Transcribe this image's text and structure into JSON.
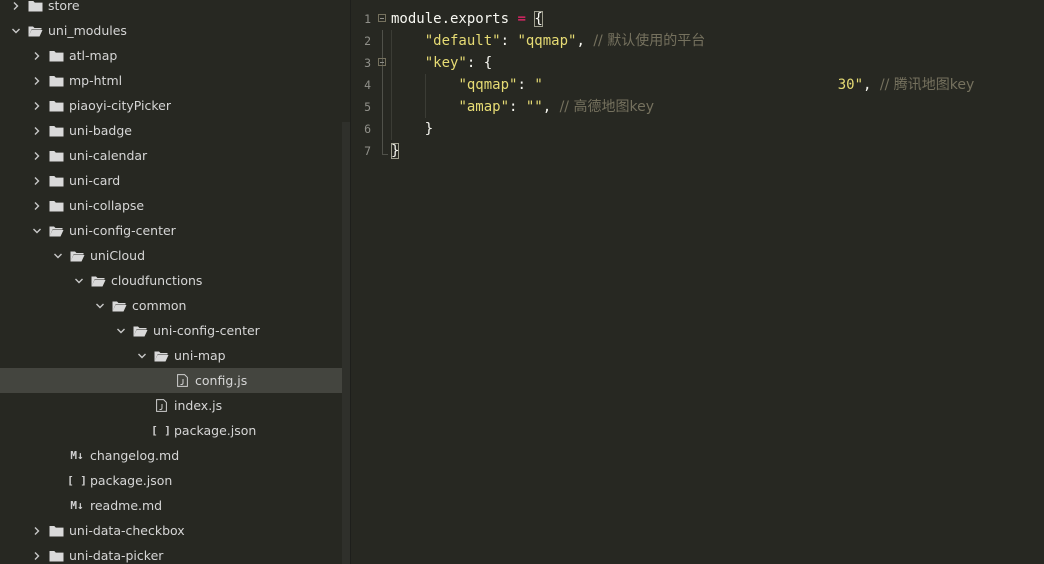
{
  "explorer": {
    "rows": [
      {
        "label": "store",
        "type": "folder",
        "expanded": false,
        "depth": 0
      },
      {
        "label": "uni_modules",
        "type": "folder",
        "expanded": true,
        "depth": 0
      },
      {
        "label": "atl-map",
        "type": "folder",
        "expanded": false,
        "depth": 1
      },
      {
        "label": "mp-html",
        "type": "folder",
        "expanded": false,
        "depth": 1
      },
      {
        "label": "piaoyi-cityPicker",
        "type": "folder",
        "expanded": false,
        "depth": 1
      },
      {
        "label": "uni-badge",
        "type": "folder",
        "expanded": false,
        "depth": 1
      },
      {
        "label": "uni-calendar",
        "type": "folder",
        "expanded": false,
        "depth": 1
      },
      {
        "label": "uni-card",
        "type": "folder",
        "expanded": false,
        "depth": 1
      },
      {
        "label": "uni-collapse",
        "type": "folder",
        "expanded": false,
        "depth": 1
      },
      {
        "label": "uni-config-center",
        "type": "folder",
        "expanded": true,
        "depth": 1
      },
      {
        "label": "uniCloud",
        "type": "folder",
        "expanded": true,
        "depth": 2
      },
      {
        "label": "cloudfunctions",
        "type": "folder",
        "expanded": true,
        "depth": 3
      },
      {
        "label": "common",
        "type": "folder",
        "expanded": true,
        "depth": 4
      },
      {
        "label": "uni-config-center",
        "type": "folder",
        "expanded": true,
        "depth": 5
      },
      {
        "label": "uni-map",
        "type": "folder",
        "expanded": true,
        "depth": 6
      },
      {
        "label": "config.js",
        "type": "js",
        "depth": 7,
        "selected": true
      },
      {
        "label": "index.js",
        "type": "js",
        "depth": 6
      },
      {
        "label": "package.json",
        "type": "json",
        "depth": 6
      },
      {
        "label": "changelog.md",
        "type": "md",
        "depth": 2
      },
      {
        "label": "package.json",
        "type": "json",
        "depth": 2
      },
      {
        "label": "readme.md",
        "type": "md",
        "depth": 2
      },
      {
        "label": "uni-data-checkbox",
        "type": "folder",
        "expanded": false,
        "depth": 1
      },
      {
        "label": "uni-data-picker",
        "type": "folder",
        "expanded": false,
        "depth": 1
      }
    ],
    "icons": {
      "json": "[ ]",
      "md": "M↓"
    }
  },
  "editor": {
    "lines": [
      {
        "n": "1",
        "fold": true,
        "tokens": [
          [
            "pun",
            "module.exports "
          ],
          [
            "op",
            "="
          ],
          [
            "pun",
            " "
          ],
          [
            "brace",
            "{"
          ]
        ]
      },
      {
        "n": "2",
        "fold": false,
        "tokens": [
          [
            "pun",
            "    "
          ],
          [
            "key",
            "\"default\""
          ],
          [
            "pun",
            ": "
          ],
          [
            "str",
            "\"qqmap\""
          ],
          [
            "pun",
            ", "
          ],
          [
            "cmt",
            "// 默认使用的平台"
          ]
        ]
      },
      {
        "n": "3",
        "fold": true,
        "tokens": [
          [
            "pun",
            "    "
          ],
          [
            "key",
            "\"key\""
          ],
          [
            "pun",
            ": {"
          ]
        ]
      },
      {
        "n": "4",
        "fold": false,
        "tokens": [
          [
            "pun",
            "        "
          ],
          [
            "key",
            "\"qqmap\""
          ],
          [
            "pun",
            ": "
          ],
          [
            "str",
            "\"                                   30\""
          ],
          [
            "pun",
            ", "
          ],
          [
            "cmt",
            "// 腾讯地图key"
          ]
        ]
      },
      {
        "n": "5",
        "fold": false,
        "tokens": [
          [
            "pun",
            "        "
          ],
          [
            "key",
            "\"amap\""
          ],
          [
            "pun",
            ": "
          ],
          [
            "str",
            "\"\""
          ],
          [
            "pun",
            ", "
          ],
          [
            "cmt",
            "// 高德地图key"
          ]
        ]
      },
      {
        "n": "6",
        "fold": false,
        "tokens": [
          [
            "pun",
            "    }"
          ]
        ]
      },
      {
        "n": "7",
        "fold": false,
        "tokens": [
          [
            "brace",
            "}"
          ]
        ]
      }
    ]
  },
  "colors": {
    "background": "#272822",
    "selection": "#44453f",
    "string": "#e6db74",
    "operator": "#f92672",
    "comment": "#75715e",
    "text": "#f8f8f2"
  }
}
